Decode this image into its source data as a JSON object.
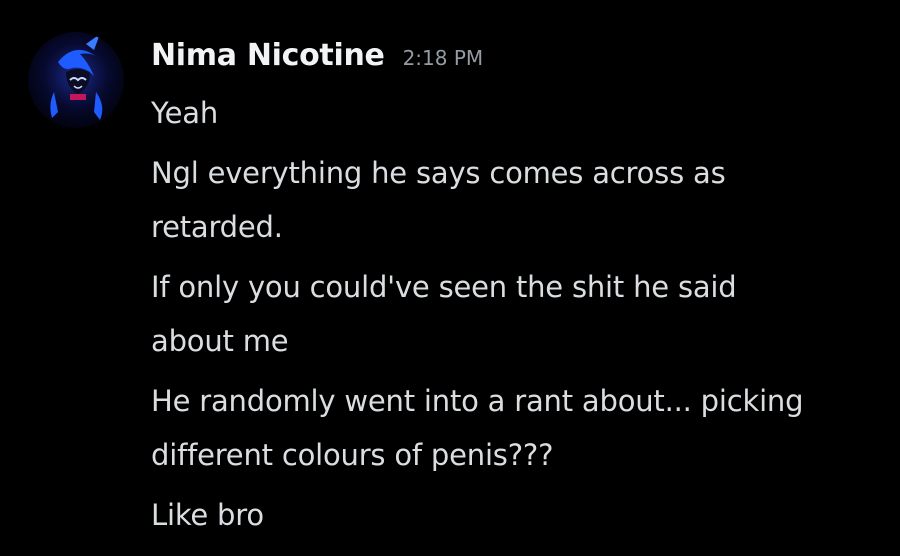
{
  "message": {
    "username": "Nima Nicotine",
    "timestamp": "2:18 PM",
    "avatar_icon": "anime-character-avatar-icon",
    "lines": [
      "Yeah",
      "Ngl everything he says comes across as\nretarded.",
      "If only you could've seen the shit he said\nabout me",
      "He randomly went into a rant about... picking\ndifferent colours of penis???",
      "Like bro"
    ]
  },
  "colors": {
    "background": "#000000",
    "username": "#f2f3f5",
    "timestamp": "#949ba4",
    "message_text": "#dbdee1",
    "avatar_accent": "#1e5cff"
  }
}
